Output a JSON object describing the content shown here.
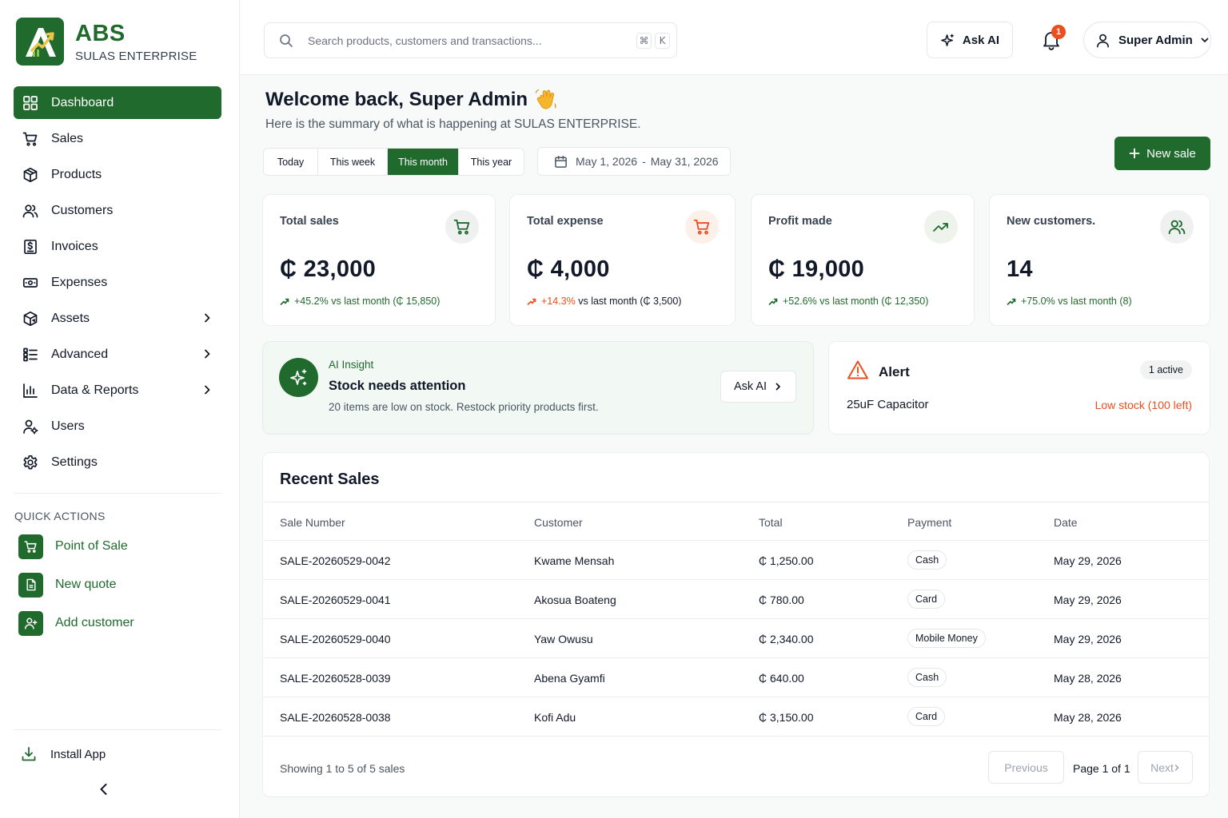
{
  "brand": {
    "name": "ABS",
    "subtitle": "SULAS ENTERPRISE"
  },
  "nav": [
    {
      "label": "Dashboard",
      "icon": "dashboard-icon",
      "active": true
    },
    {
      "label": "Sales",
      "icon": "cart-icon"
    },
    {
      "label": "Products",
      "icon": "box-icon"
    },
    {
      "label": "Customers",
      "icon": "users-icon"
    },
    {
      "label": "Invoices",
      "icon": "invoice-icon"
    },
    {
      "label": "Expenses",
      "icon": "wallet-icon"
    },
    {
      "label": "Assets",
      "icon": "assets-icon",
      "expandable": true
    },
    {
      "label": "Advanced",
      "icon": "list-icon",
      "expandable": true
    },
    {
      "label": "Data & Reports",
      "icon": "chart-icon",
      "expandable": true
    },
    {
      "label": "Users",
      "icon": "user-gear-icon"
    },
    {
      "label": "Settings",
      "icon": "gear-icon"
    }
  ],
  "quick_actions": {
    "title": "QUICK ACTIONS",
    "items": [
      {
        "label": "Point of Sale",
        "icon": "cart-icon"
      },
      {
        "label": "New quote",
        "icon": "document-icon"
      },
      {
        "label": "Add customer",
        "icon": "user-plus-icon"
      }
    ]
  },
  "sidebar_footer": {
    "install_label": "Install App"
  },
  "topbar": {
    "search_placeholder": "Search products, customers and transactions...",
    "shortcut_keys": [
      "⌘",
      "K"
    ],
    "ask_ai_label": "Ask AI",
    "notification_count": "1",
    "user_name": "Super Admin"
  },
  "welcome": {
    "title": "Welcome back, Super Admin",
    "subtitle": "Here is the summary of what is happening at SULAS ENTERPRISE."
  },
  "period_tabs": [
    {
      "label": "Today"
    },
    {
      "label": "This week"
    },
    {
      "label": "This month",
      "active": true
    },
    {
      "label": "This year"
    }
  ],
  "date_range": {
    "start": "May 1, 2026",
    "separator": "-",
    "end": "May 31, 2026"
  },
  "new_sale_label": "New sale",
  "stats": [
    {
      "label": "Total sales",
      "value": "₵ 23,000",
      "change": "+45.2%",
      "change_rest": "vs last month (₵ 15,850)",
      "trend": "up",
      "icon": "cart-icon",
      "color": "#1f6a2c"
    },
    {
      "label": "Total expense",
      "value": "₵ 4,000",
      "change": "+14.3%",
      "change_rest": "vs last month (₵ 3,500)",
      "trend": "up-bad",
      "icon": "cart-icon",
      "color": "#ea4f1d"
    },
    {
      "label": "Profit made",
      "value": "₵ 19,000",
      "change": "+52.6%",
      "change_rest": "vs last month (₵ 12,350)",
      "trend": "up",
      "icon": "trending-up-icon",
      "color": "#1f6a2c"
    },
    {
      "label": "New customers.",
      "value": "14",
      "change": "+75.0%",
      "change_rest": "vs last month (8)",
      "trend": "up",
      "icon": "users-icon",
      "color": "#1f6a2c"
    }
  ],
  "insight": {
    "tag": "AI Insight",
    "title": "Stock needs attention",
    "message": "20 items are low on stock. Restock priority products first.",
    "button_label": "Ask AI"
  },
  "alert": {
    "title": "Alert",
    "badge": "1 active",
    "item": "25uF Capacitor",
    "status": "Low stock (100 left)"
  },
  "recent_sales": {
    "title": "Recent Sales",
    "columns": [
      "Sale Number",
      "Customer",
      "Total",
      "Payment",
      "Date"
    ],
    "rows": [
      [
        "SALE-20260529-0042",
        "Kwame Mensah",
        "₵ 1,250.00",
        "Cash",
        "May 29, 2026"
      ],
      [
        "SALE-20260529-0041",
        "Akosua Boateng",
        "₵ 780.00",
        "Card",
        "May 29, 2026"
      ],
      [
        "SALE-20260529-0040",
        "Yaw Owusu",
        "₵ 2,340.00",
        "Mobile Money",
        "May 29, 2026"
      ],
      [
        "SALE-20260528-0039",
        "Abena Gyamfi",
        "₵ 640.00",
        "Cash",
        "May 28, 2026"
      ],
      [
        "SALE-20260528-0038",
        "Kofi Adu",
        "₵ 3,150.00",
        "Card",
        "May 28, 2026"
      ]
    ],
    "footer": {
      "showing": "Showing 1 to 5 of 5 sales",
      "previous_label": "Previous",
      "page_info": "Page 1 of 1",
      "next_label": "Next"
    }
  }
}
